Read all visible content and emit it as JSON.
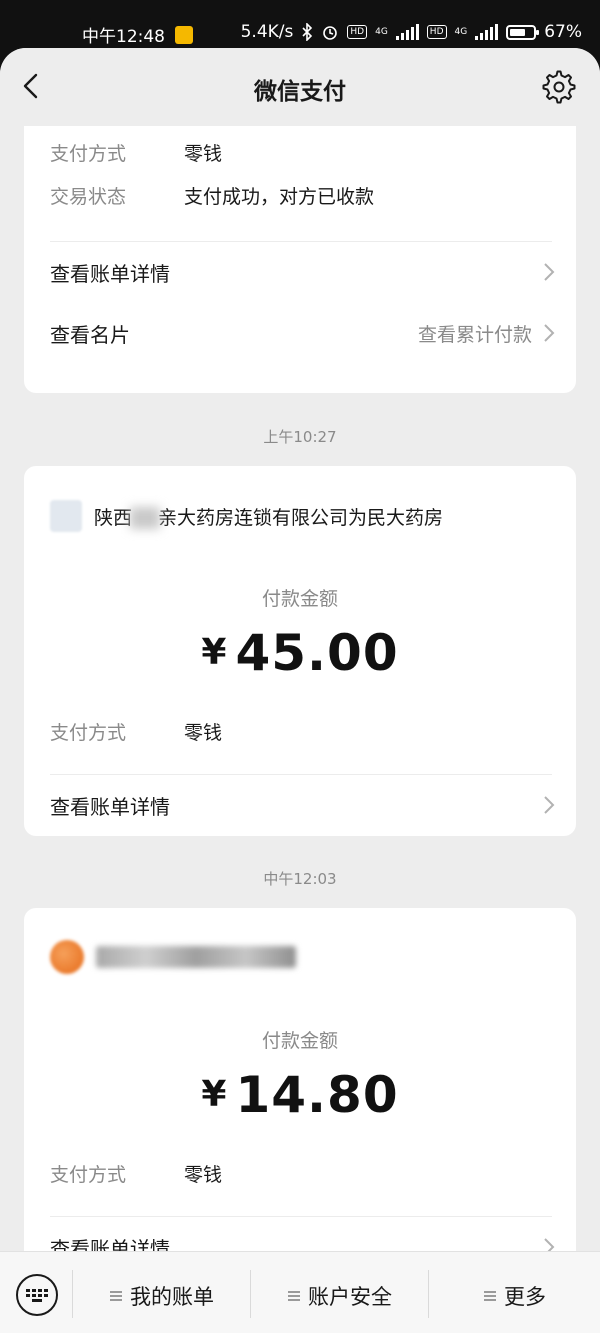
{
  "status_bar": {
    "time": "中午12:48",
    "speed": "5.4K/s",
    "hd1": "HD",
    "net1": "4G",
    "hd2": "HD",
    "net2": "4G",
    "battery": "67%",
    "battery_level": 0.67
  },
  "nav": {
    "title": "微信支付",
    "back_icon": "chevron-left-icon",
    "settings_icon": "gear-icon"
  },
  "card1": {
    "pay_method_label": "支付方式",
    "pay_method_value": "零钱",
    "status_label": "交易状态",
    "status_value": "支付成功，对方已收款",
    "bill_detail": "查看账单详情",
    "business_card": "查看名片",
    "cumulative": "查看累计付款"
  },
  "time1": "上午10:27",
  "card2": {
    "merchant_prefix": "陕西",
    "merchant_suffix": "亲大药房连锁有限公司为民大药房",
    "amount_label": "付款金额",
    "currency": "¥",
    "amount": "45.00",
    "pay_method_label": "支付方式",
    "pay_method_value": "零钱",
    "bill_detail": "查看账单详情"
  },
  "time2": "中午12:03",
  "card3": {
    "amount_label": "付款金额",
    "currency": "¥",
    "amount": "14.80",
    "pay_method_label": "支付方式",
    "pay_method_value": "零钱",
    "bill_detail": "查看账单详情"
  },
  "bottom_bar": {
    "keyboard_icon": "keyboard-icon",
    "menu1": "我的账单",
    "menu2": "账户安全",
    "menu3": "更多"
  }
}
